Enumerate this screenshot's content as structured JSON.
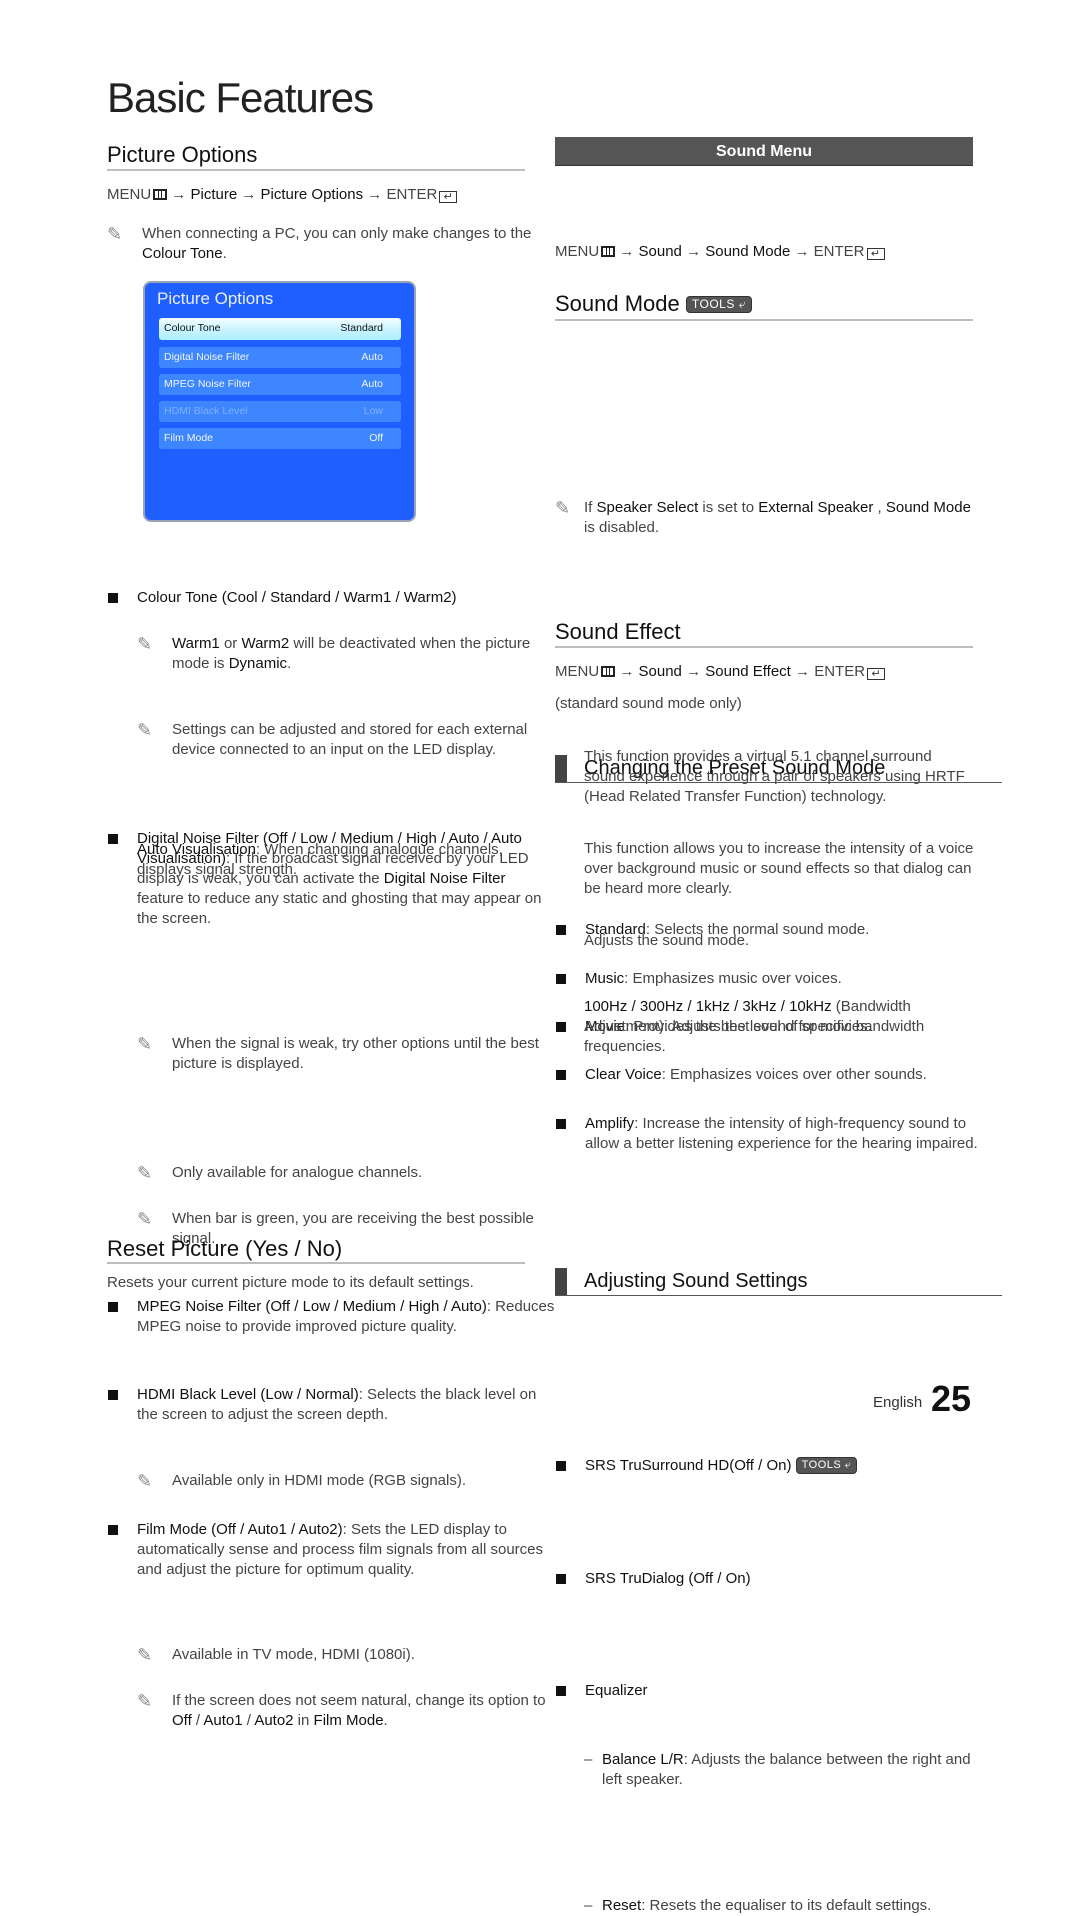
{
  "page": {
    "title": "Basic Features",
    "language": "English",
    "number": "25"
  },
  "picture_options": {
    "heading": "Picture Options",
    "menu_path": {
      "menu": "MENU",
      "steps": [
        "Picture",
        "Picture Options"
      ],
      "enter": "ENTER",
      "arrow": "→"
    },
    "note_pc": {
      "pre": "When connecting a PC, you can only make changes to the",
      "bold": "Colour Tone",
      "post": "."
    },
    "osd": {
      "title": "Picture Options",
      "rows": [
        {
          "label": "Colour Tone",
          "value": "Standard",
          "state": "selected"
        },
        {
          "label": "Digital Noise Filter",
          "value": "Auto",
          "state": "normal"
        },
        {
          "label": "MPEG Noise Filter",
          "value": "Auto",
          "state": "normal"
        },
        {
          "label": "HDMI Black Level",
          "value": "Low",
          "state": "disabled"
        },
        {
          "label": "Film Mode",
          "value": "Off",
          "state": "normal"
        }
      ],
      "colors": {
        "panel": "#1f5fff",
        "row": "#3d86ff",
        "selected": "#c6f3ff"
      }
    },
    "items": {
      "colour_tone": {
        "title": "Colour Tone (Cool / Standard / Warm1 / Warm2)",
        "note1": {
          "b1": "Warm1",
          "t1": " or ",
          "b2": "Warm2",
          "t2": " will be deactivated when the picture mode is ",
          "b3": "Dynamic",
          "t3": "."
        },
        "note2": "Settings can be adjusted and stored for each external device connected to an input on the LED display."
      },
      "digital_noise": {
        "title": "Digital Noise Filter (Off / Low / Medium / High / Auto / Auto Visualisation)",
        "t1": ": If the broadcast signal received by your LED display is weak, you can activate the ",
        "b1": "Digital Noise Filter",
        "t2": " feature to reduce any static and ghosting that may appear on the screen.",
        "note1": "When the signal is weak, try other options until the best picture is displayed.",
        "auto_vis_label": "Auto Visualisation",
        "auto_vis_text": ": When changing analogue channels, displays signal strength.",
        "note2": "Only available for analogue channels.",
        "note3": "When bar is green, you are receiving the best possible signal."
      },
      "mpeg_noise": {
        "title": "MPEG Noise Filter (Off / Low / Medium / High / Auto)",
        "text": ": Reduces MPEG noise to provide improved picture quality."
      },
      "hdmi_black": {
        "title": "HDMI Black Level (Low / Normal)",
        "text": ": Selects the black level on the screen to adjust the screen depth.",
        "note": "Available only in HDMI mode (RGB signals)."
      },
      "film_mode": {
        "title": "Film Mode (Off / Auto1 / Auto2)",
        "text": ": Sets the LED display to automatically sense and process film signals from all sources and adjust the picture for optimum quality.",
        "note1": "Available in TV mode, HDMI (1080i).",
        "note2": {
          "t1": "If the screen does not seem natural, change its option to ",
          "b1": "Off",
          "t2": " / ",
          "b2": "Auto1",
          "t3": " / ",
          "b3": "Auto2",
          "t4": " in ",
          "b4": "Film Mode",
          "t5": "."
        }
      }
    }
  },
  "reset_picture": {
    "heading": "Reset Picture (Yes / No)",
    "text": "Resets your current picture mode to its default settings."
  },
  "sound_menu": {
    "banner": "Sound Menu",
    "preset_heading": "Changing the Preset Sound Mode",
    "preset_path": {
      "menu": "MENU",
      "steps": [
        "Sound",
        "Sound Mode"
      ],
      "enter": "ENTER",
      "arrow": "→"
    },
    "sound_mode": {
      "heading": "Sound Mode",
      "tools_label": "TOOLS",
      "items": [
        {
          "label": "Standard",
          "text": ": Selects the normal sound mode."
        },
        {
          "label": "Music",
          "text": ": Emphasizes music over voices."
        },
        {
          "label": "Movie",
          "text": ": Provides the best sound for movies."
        },
        {
          "label": "Clear Voice",
          "text": ": Emphasizes voices over other sounds."
        },
        {
          "label": "Amplify",
          "text": ": Increase the intensity of high-frequency sound to allow a better listening experience for the hearing impaired."
        }
      ],
      "note": {
        "t1": "If ",
        "b1": "Speaker Select",
        "t2": " is set to ",
        "b2": "External Speaker",
        "t3": " , ",
        "b3": "Sound Mode",
        "t4": " is disabled."
      }
    },
    "adjust_heading": "Adjusting Sound Settings",
    "sound_effect": {
      "heading": "Sound Effect",
      "path": {
        "menu": "MENU",
        "steps": [
          "Sound",
          "Sound Effect"
        ],
        "enter": "ENTER",
        "arrow": "→"
      },
      "qualifier": "(standard sound mode only)",
      "trusurround": {
        "title": "SRS TruSurround HD(Off / On)",
        "tools_label": "TOOLS",
        "text": "This function provides a virtual 5.1 channel surround sound experience through a pair of speakers using HRTF (Head Related Transfer Function) technology."
      },
      "trudialog": {
        "title": "SRS TruDialog (Off / On)",
        "text": "This function allows you to increase the intensity of a voice over background music or sound effects so that dialog can be heard more clearly."
      },
      "equalizer": {
        "title": "Equalizer",
        "text": "Adjusts the sound mode.",
        "balance_label": "Balance L/R",
        "balance_text": ": Adjusts the balance between the right and left speaker.",
        "bands_label": "100Hz / 300Hz / 1kHz / 3kHz / 10kHz",
        "bands_text": " (Bandwidth Adjustment): Adjusts the level of specific bandwidth frequencies.",
        "reset_label": "Reset",
        "reset_text": ": Resets the equaliser to its default settings.",
        "dash": "–"
      }
    }
  }
}
